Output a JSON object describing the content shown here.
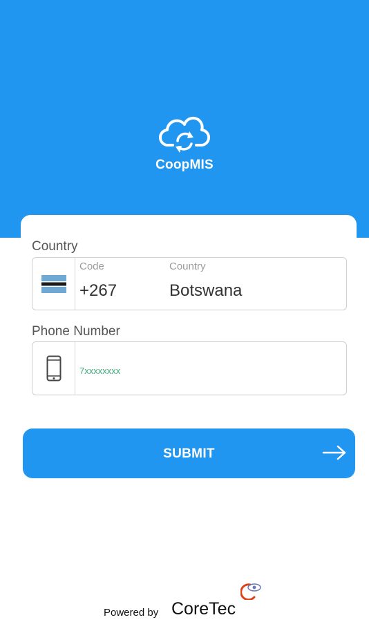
{
  "app": {
    "brand_name": "CoopMIS"
  },
  "country_section": {
    "label": "Country",
    "code_label": "Code",
    "code_value": "+267",
    "country_label": "Country",
    "country_value": "Botswana",
    "flag_icon": "botswana-flag-icon"
  },
  "phone_section": {
    "label": "Phone Number",
    "placeholder": "7xxxxxxxx",
    "icon": "mobile-phone-icon"
  },
  "submit": {
    "label": "SUBMIT",
    "icon": "arrow-right-icon"
  },
  "footer": {
    "powered_by": "Powered by",
    "company": "CoreTec"
  },
  "colors": {
    "primary": "#2196f0",
    "placeholder_text": "#3aa876",
    "border": "#cfcfcf"
  }
}
